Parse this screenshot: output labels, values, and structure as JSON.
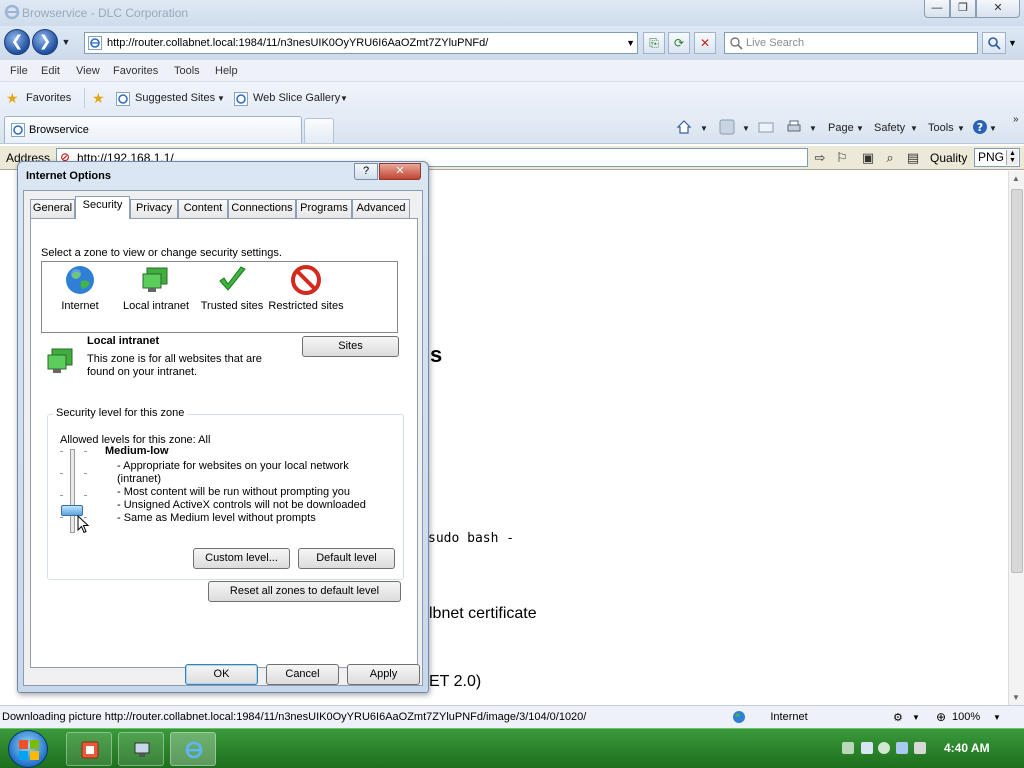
{
  "window": {
    "title": "Browservice - DLC Corporation",
    "minimize_label": "—",
    "maximize_label": "❐",
    "close_label": "✕"
  },
  "navbar": {
    "url": "http://router.collabnet.local:1984/11/n3nesUIK0OyYRU6I6AaOZmt7ZYluPNFd/",
    "search_placeholder": "Live Search"
  },
  "menu": [
    "File",
    "Edit",
    "View",
    "Favorites",
    "Tools",
    "Help"
  ],
  "favorites_bar": {
    "favorites_label": "Favorites",
    "suggested_label": "Suggested Sites",
    "webslice_label": "Web Slice Gallery"
  },
  "tabs": {
    "active_label": "Browservice"
  },
  "command_bar": {
    "page_label": "Page",
    "safety_label": "Safety",
    "tools_label": "Tools"
  },
  "address_bar": {
    "label": "Address",
    "value": "http://192.168.1.1/",
    "quality_label": "Quality",
    "quality_value": "PNG"
  },
  "page_fragments": {
    "frag_sites": "s",
    "frag_bash": "sudo bash -",
    "frag_cert": "lbnet certificate",
    "frag_net": "ET 2.0)"
  },
  "dialog": {
    "title": "Internet Options",
    "help_label": "?",
    "close_label": "✕",
    "tabs": [
      "General",
      "Security",
      "Privacy",
      "Content",
      "Connections",
      "Programs",
      "Advanced"
    ],
    "active_tab": "Security",
    "zone_prompt": "Select a zone to view or change security settings.",
    "zones": [
      {
        "label": "Internet",
        "icon": "globe-icon"
      },
      {
        "label": "Local intranet",
        "icon": "monitor-icon"
      },
      {
        "label": "Trusted sites",
        "icon": "checkmark-icon"
      },
      {
        "label": "Restricted sites",
        "icon": "prohibited-icon"
      }
    ],
    "selected_zone_title": "Local intranet",
    "selected_zone_desc_1": "This zone is for all websites that are",
    "selected_zone_desc_2": "found on your intranet.",
    "sites_button": "Sites",
    "security_group_label": "Security level for this zone",
    "allowed_levels": "Allowed levels for this zone: All",
    "level_name": "Medium-low",
    "level_bullets": [
      "- Appropriate for websites on your local network",
      "(intranet)",
      "- Most content will be run without prompting you",
      "- Unsigned ActiveX controls will not be downloaded",
      "- Same as Medium level without prompts"
    ],
    "custom_level_button": "Custom level...",
    "default_level_button": "Default level",
    "reset_all_button": "Reset all zones to default level",
    "ok_button": "OK",
    "cancel_button": "Cancel",
    "apply_button": "Apply"
  },
  "statusbar": {
    "message": "Downloading picture http://router.collabnet.local:1984/11/n3nesUIK0OyYRU6I6AaOZmt7ZYluPNFd/image/3/104/0/1020/",
    "zone": "Internet",
    "zoom": "100%"
  },
  "taskbar": {
    "clock": "4:40 AM"
  }
}
